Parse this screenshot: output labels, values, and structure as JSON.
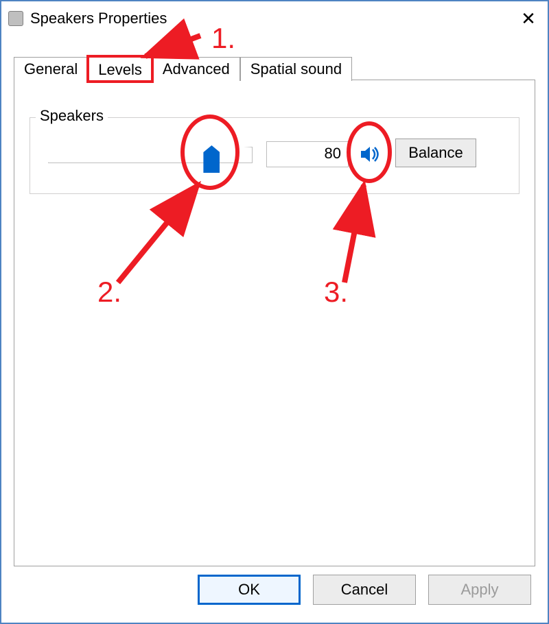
{
  "window": {
    "title": "Speakers Properties"
  },
  "tabs": {
    "general": "General",
    "levels": "Levels",
    "advanced": "Advanced",
    "spatial": "Spatial sound",
    "active": "levels"
  },
  "group": {
    "legend": "Speakers",
    "volume_value": "80",
    "volume_pct": 0.8,
    "balance_label": "Balance",
    "mute_state": "unmuted"
  },
  "buttons": {
    "ok": "OK",
    "cancel": "Cancel",
    "apply": "Apply"
  },
  "annotations": {
    "n1": "1.",
    "n2": "2.",
    "n3": "3."
  },
  "colors": {
    "accent": "#0066cc",
    "annotation": "#ed1c24"
  }
}
